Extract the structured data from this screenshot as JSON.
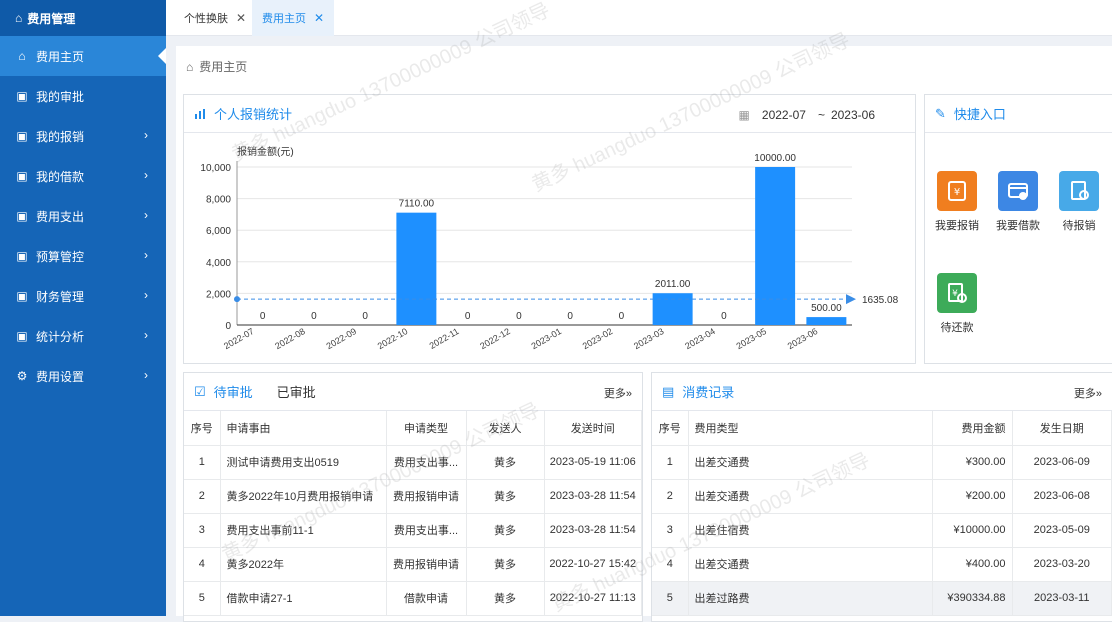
{
  "sidebar": {
    "header": "费用管理",
    "items": [
      {
        "label": "费用主页"
      },
      {
        "label": "我的审批"
      },
      {
        "label": "我的报销"
      },
      {
        "label": "我的借款"
      },
      {
        "label": "费用支出"
      },
      {
        "label": "预算管控"
      },
      {
        "label": "财务管理"
      },
      {
        "label": "统计分析"
      },
      {
        "label": "费用设置"
      }
    ]
  },
  "tabs": [
    {
      "label": "个性换肤"
    },
    {
      "label": "费用主页"
    }
  ],
  "breadcrumb": "费用主页",
  "stats": {
    "title": "个人报销统计",
    "date_from": "2022-07",
    "date_sep": "~",
    "date_to": "2023-06"
  },
  "chart_data": {
    "type": "bar",
    "ylabel": "报销金额(元)",
    "ylim": [
      0,
      10000
    ],
    "yticks": [
      "0",
      "2,000",
      "4,000",
      "6,000",
      "8,000",
      "10,000"
    ],
    "categories": [
      "2022-07",
      "2022-08",
      "2022-09",
      "2022-10",
      "2022-11",
      "2022-12",
      "2023-01",
      "2023-02",
      "2023-03",
      "2023-04",
      "2023-05",
      "2023-06"
    ],
    "values": [
      0,
      0,
      0,
      7110,
      0,
      0,
      0,
      0,
      2011,
      0,
      10000,
      500
    ],
    "value_labels": [
      "0",
      "0",
      "0",
      "7110.00",
      "0",
      "0",
      "0",
      "0",
      "2011.00",
      "0",
      "10000.00",
      "500.00"
    ],
    "average": 1635.08,
    "average_label": "1635.08",
    "color": "#1e90ff"
  },
  "quick": {
    "title": "快捷入口",
    "items": [
      {
        "label": "我要报销",
        "color": "#f07e1f"
      },
      {
        "label": "我要借款",
        "color": "#3d87e4"
      },
      {
        "label": "待报销",
        "color": "#47a9e8"
      },
      {
        "label": "待还款",
        "color": "#3dab59"
      }
    ]
  },
  "approval": {
    "tab_pending": "待审批",
    "tab_done": "已审批",
    "more": "更多»",
    "headers": [
      "序号",
      "申请事由",
      "申请类型",
      "发送人",
      "发送时间"
    ],
    "rows": [
      [
        "1",
        "测试申请费用支出0519",
        "费用支出事...",
        "黄多",
        "2023-05-19 11:06"
      ],
      [
        "2",
        "黄多2022年10月费用报销申请",
        "费用报销申请",
        "黄多",
        "2023-03-28 11:54"
      ],
      [
        "3",
        "费用支出事前11-1",
        "费用支出事...",
        "黄多",
        "2023-03-28 11:54"
      ],
      [
        "4",
        "黄多2022年",
        "费用报销申请",
        "黄多",
        "2022-10-27 15:42"
      ],
      [
        "5",
        "借款申请27-1",
        "借款申请",
        "黄多",
        "2022-10-27 11:13"
      ]
    ]
  },
  "records": {
    "title": "消费记录",
    "more": "更多»",
    "headers": [
      "序号",
      "费用类型",
      "费用金额",
      "发生日期"
    ],
    "rows": [
      [
        "1",
        "出差交通费",
        "¥300.00",
        "2023-06-09"
      ],
      [
        "2",
        "出差交通费",
        "¥200.00",
        "2023-06-08"
      ],
      [
        "3",
        "出差住宿费",
        "¥10000.00",
        "2023-05-09"
      ],
      [
        "4",
        "出差交通费",
        "¥400.00",
        "2023-03-20"
      ],
      [
        "5",
        "出差过路费",
        "¥390334.88",
        "2023-03-11"
      ]
    ]
  },
  "watermark": "黄多 huangduo 13700000009 公司领导"
}
